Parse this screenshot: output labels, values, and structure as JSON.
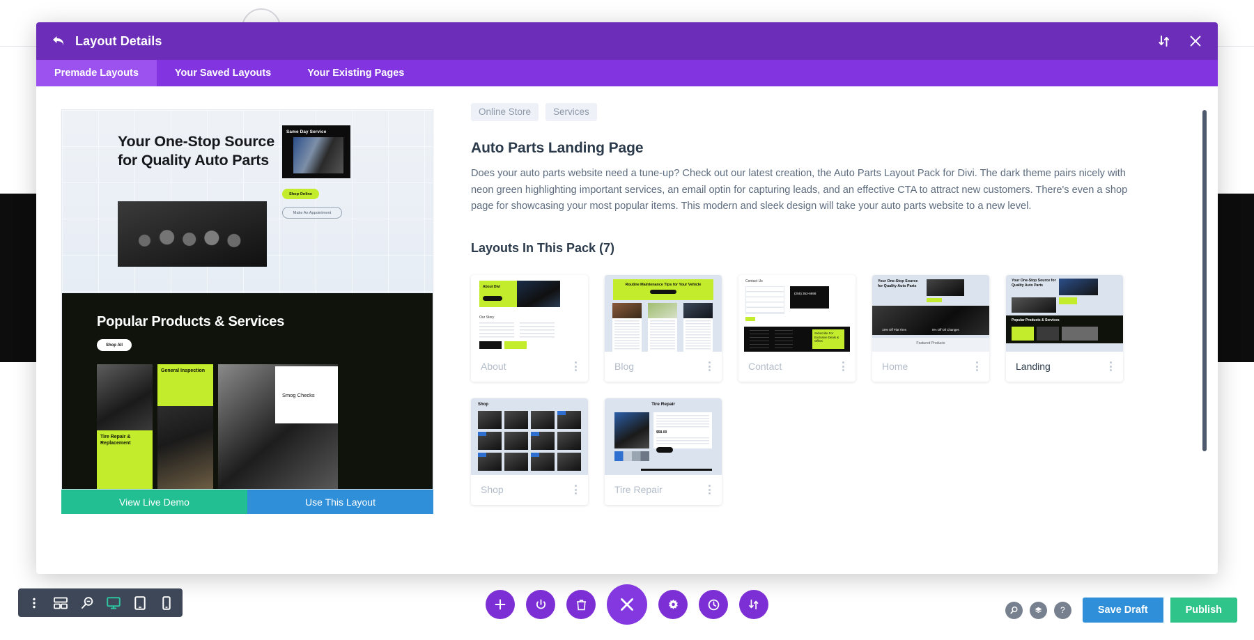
{
  "modal": {
    "header": {
      "title": "Layout Details",
      "back_icon": "back-arrow-icon",
      "sort_icon": "sort-updown-icon",
      "close_icon": "close-x-icon"
    },
    "tabs": [
      {
        "label": "Premade Layouts",
        "active": true
      },
      {
        "label": "Your Saved Layouts",
        "active": false
      },
      {
        "label": "Your Existing Pages",
        "active": false
      }
    ]
  },
  "preview": {
    "hero_headline": "Your One-Stop Source for Quality Auto Parts",
    "badge_label": "Same Day Service",
    "cta_primary": "Shop Online",
    "cta_secondary": "Make An Appointment",
    "dark_title": "Popular Products & Services",
    "dark_pill": "Shop All",
    "tiles": [
      {
        "label": "Tire Repair & Replacement"
      },
      {
        "label": "General Inspection"
      },
      {
        "label": "Smog Checks"
      }
    ],
    "actions": {
      "demo_label": "View Live Demo",
      "use_label": "Use This Layout"
    }
  },
  "detail": {
    "tags": [
      "Online Store",
      "Services"
    ],
    "title": "Auto Parts Landing Page",
    "description": "Does your auto parts website need a tune-up? Check out our latest creation, the Auto Parts Layout Pack for Divi. The dark theme pairs nicely with neon green highlighting important services, an email optin for capturing leads, and an effective CTA to attract new customers. There's even a shop page for showcasing your most popular items. This modern and sleek design will take your auto parts website to a new level.",
    "pack_heading": "Layouts In This Pack (7)",
    "layouts": [
      {
        "name": "About",
        "selected": false,
        "kebab": "kebab-menu-icon"
      },
      {
        "name": "Blog",
        "selected": false,
        "kebab": "kebab-menu-icon"
      },
      {
        "name": "Contact",
        "selected": false,
        "kebab": "kebab-menu-icon"
      },
      {
        "name": "Home",
        "selected": false,
        "kebab": "kebab-menu-icon"
      },
      {
        "name": "Landing",
        "selected": true,
        "kebab": "kebab-menu-icon"
      },
      {
        "name": "Shop",
        "selected": false,
        "kebab": "kebab-menu-icon"
      },
      {
        "name": "Tire Repair",
        "selected": false,
        "kebab": "kebab-menu-icon"
      }
    ],
    "thumb_text": {
      "about_title": "About Divi",
      "about_section": "Our Story",
      "blog_title": "Routine Maintenance Tips for Your Vehicle",
      "contact_title": "Contact Us",
      "contact_phone": "(255) 352-6698",
      "contact_cta": "Subscribe For Exclusive Deals & Offers",
      "home_headline": "Your One-Stop Source for Quality Auto Parts",
      "home_featured": "Featured Products",
      "home_stat_1": "15% Off Flat Tires",
      "home_stat_2": "5% Off Oil Changes",
      "landing_headline": "Your One-Stop Source for Quality Auto Parts",
      "landing_section": "Popular Products & Services",
      "shop_title": "Shop",
      "tire_title": "Tire Repair",
      "tire_price": "$58.00"
    }
  },
  "toolbars": {
    "left": [
      {
        "icon": "kebab-menu-icon",
        "name": "more-options-button",
        "active": false
      },
      {
        "icon": "wireframe-icon",
        "name": "wireframe-view-button",
        "active": false
      },
      {
        "icon": "zoom-out-icon",
        "name": "zoom-view-button",
        "active": false
      },
      {
        "icon": "desktop-icon",
        "name": "desktop-view-button",
        "active": true
      },
      {
        "icon": "tablet-icon",
        "name": "tablet-view-button",
        "active": false
      },
      {
        "icon": "phone-icon",
        "name": "phone-view-button",
        "active": false
      }
    ],
    "center": [
      {
        "icon": "plus-icon",
        "name": "add-section-button"
      },
      {
        "icon": "power-icon",
        "name": "toggle-builder-button"
      },
      {
        "icon": "trash-icon",
        "name": "delete-button"
      },
      {
        "icon": "close-x-icon",
        "name": "close-menu-button",
        "big": true
      },
      {
        "icon": "gear-icon",
        "name": "settings-button"
      },
      {
        "icon": "clock-icon",
        "name": "history-button"
      },
      {
        "icon": "sort-updown-icon",
        "name": "portability-button"
      }
    ],
    "right": {
      "icons": [
        {
          "icon": "search-icon",
          "name": "search-button"
        },
        {
          "icon": "layers-icon",
          "name": "layers-button"
        },
        {
          "icon": "help-icon",
          "name": "help-button",
          "glyph": "?"
        }
      ],
      "save_draft_label": "Save Draft",
      "publish_label": "Publish"
    }
  },
  "colors": {
    "header_purple": "#6C2EB9",
    "tabs_purple": "#8134E0",
    "tab_active": "#9B52EF",
    "demo_green": "#22BF92",
    "use_blue": "#2F8FD8",
    "publish_green": "#2EC48A",
    "toolbar_dark": "#3D4757",
    "neon_green": "#C2EC2C"
  }
}
